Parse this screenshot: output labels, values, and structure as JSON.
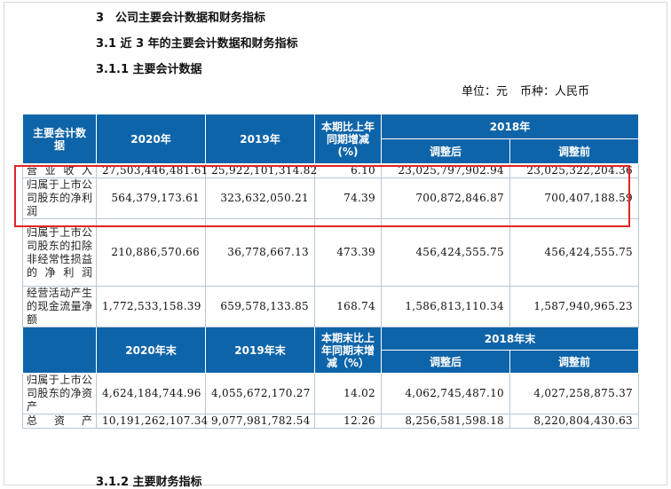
{
  "headings": {
    "section_num": "3",
    "section_title": "公司主要会计数据和财务指标",
    "sub1": "3.1 近 3 年的主要会计数据和财务指标",
    "sub2": "3.1.1 主要会计数据",
    "sub3": "3.1.2 主要财务指标"
  },
  "unit": {
    "unit_text": "单位：元",
    "currency_text": "币种：人民币"
  },
  "table1": {
    "col_item": "主要会计数据",
    "col_2020": "2020年",
    "col_2019": "2019年",
    "col_change": "本期比上年同期增减(%)",
    "col_2018": "2018年",
    "col_adjusted_after": "调整后",
    "col_adjusted_before": "调整前",
    "rows": [
      {
        "label": "营业收入",
        "v2020": "27,503,446,481.61",
        "v2019": "25,922,101,314.82",
        "change": "6.10",
        "after": "23,025,797,902.94",
        "before": "23,025,322,204.36"
      },
      {
        "label": "归属于上市公司股东的净利润",
        "v2020": "564,379,173.61",
        "v2019": "323,632,050.21",
        "change": "74.39",
        "after": "700,872,846.87",
        "before": "700,407,188.59"
      },
      {
        "label": "归属于上市公司股东的扣除非经常性损益的净利润",
        "v2020": "210,886,570.66",
        "v2019": "36,778,667.13",
        "change": "473.39",
        "after": "456,424,555.75",
        "before": "456,424,555.75"
      },
      {
        "label": "经营活动产生的现金流量净额",
        "v2020": "1,772,533,158.39",
        "v2019": "659,578,133.85",
        "change": "168.74",
        "after": "1,586,813,110.34",
        "before": "1,587,940,965.23"
      }
    ]
  },
  "table2": {
    "col_item": "",
    "col_2020": "2020年末",
    "col_2019": "2019年末",
    "col_change": "本期末比上年同期末增减（%）",
    "col_2018": "2018年末",
    "col_adjusted_after": "调整后",
    "col_adjusted_before": "调整前",
    "rows": [
      {
        "label": "归属于上市公司股东的净资产",
        "v2020": "4,624,184,744.96",
        "v2019": "4,055,672,170.27",
        "change": "14.02",
        "after": "4,062,745,487.10",
        "before": "4,027,258,875.37"
      },
      {
        "label": "总资产",
        "v2020": "10,191,262,107.34",
        "v2019": "9,077,981,782.54",
        "change": "12.26",
        "after": "8,256,581,598.18",
        "before": "8,220,804,430.63"
      }
    ]
  },
  "highlight_color": "#e02424",
  "header_color": "#0e64a8"
}
